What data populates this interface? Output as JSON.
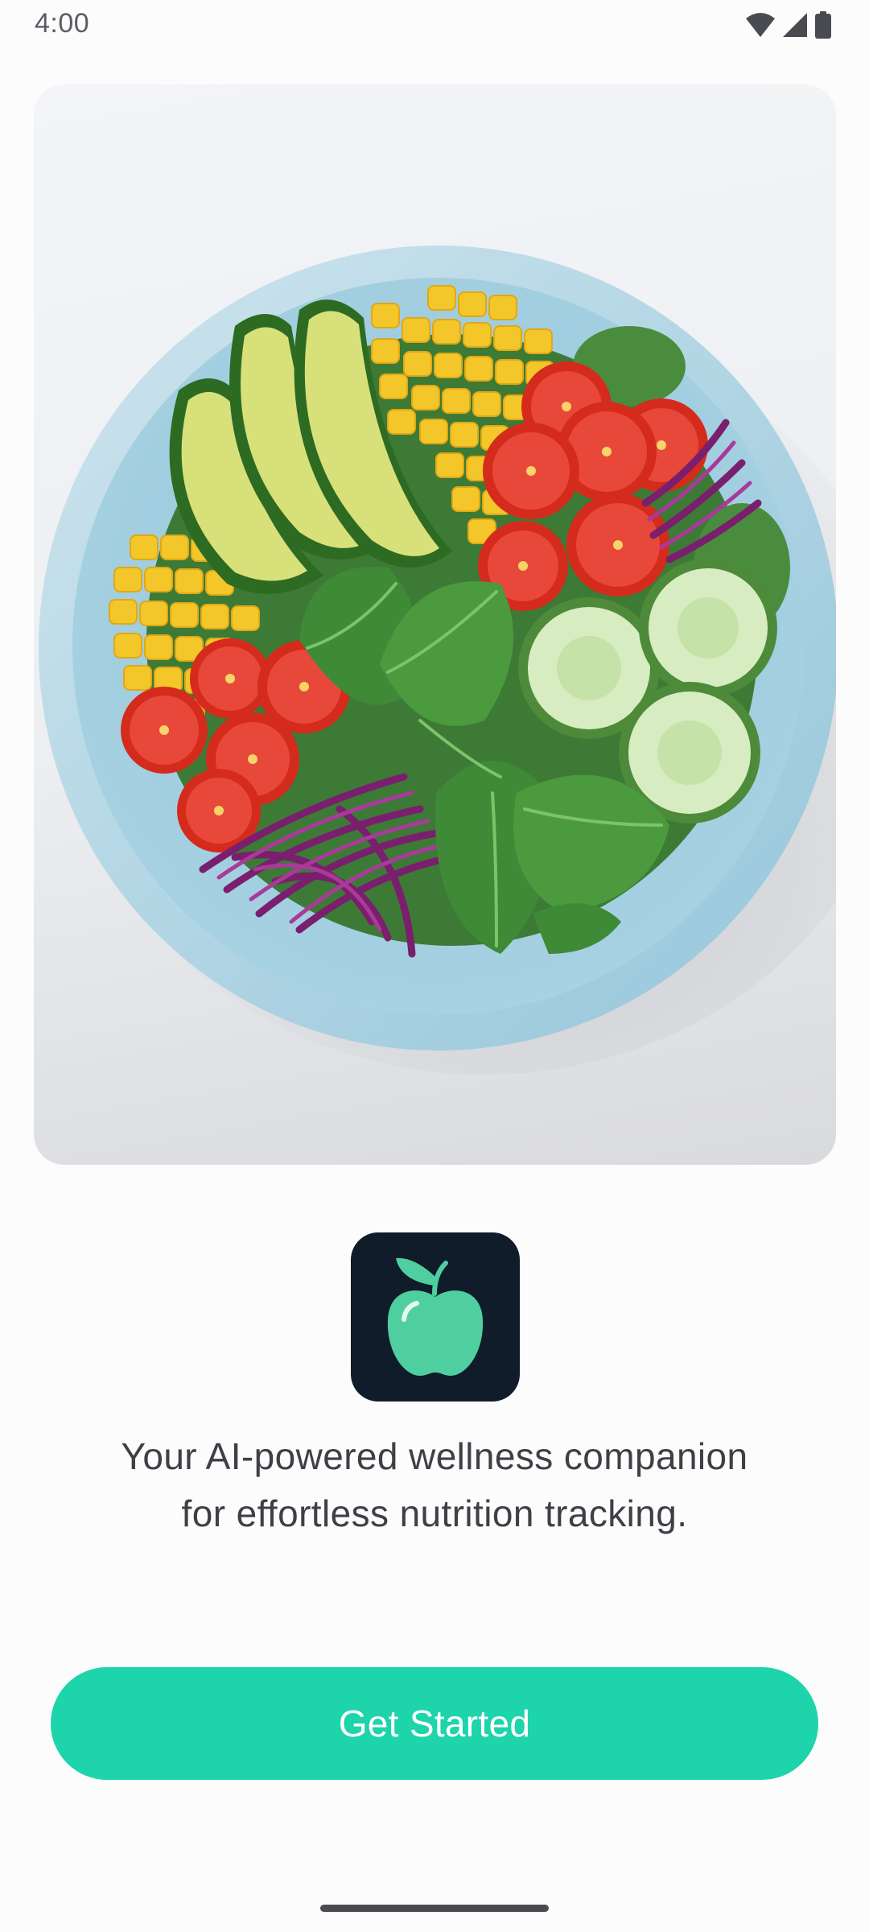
{
  "status_bar": {
    "time": "4:00",
    "icons": [
      "wifi-icon",
      "cellular-signal-icon",
      "battery-icon"
    ]
  },
  "hero": {
    "image": "salad-bowl-illustration"
  },
  "app_logo": {
    "icon": "apple-icon",
    "colors": {
      "background": "#111c2a",
      "apple": "#4fcfa0"
    }
  },
  "tagline": "Your AI-powered wellness companion for effortless nutrition tracking.",
  "cta": {
    "label": "Get Started",
    "color": "#1dd4ab"
  }
}
